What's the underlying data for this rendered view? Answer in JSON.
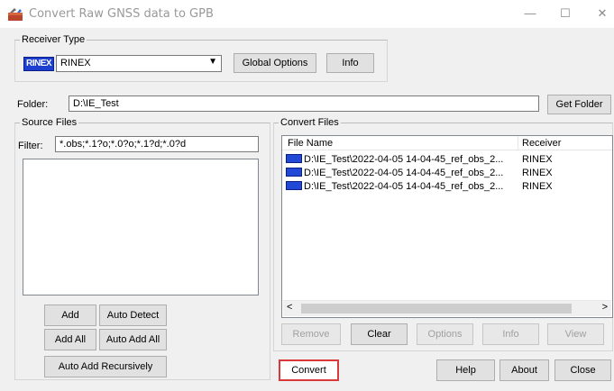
{
  "window": {
    "title": "Convert Raw GNSS data to GPB",
    "minimize_glyph": "—",
    "maximize_glyph": "☐",
    "close_glyph": "✕",
    "app_icon": "toolbox-icon"
  },
  "receiver_type": {
    "group_label": "Receiver Type",
    "badge": "RINEX",
    "selected": "RINEX",
    "global_options_label": "Global Options",
    "info_label": "Info"
  },
  "folder": {
    "label": "Folder:",
    "value": "D:\\IE_Test",
    "get_folder_label": "Get Folder"
  },
  "source_files": {
    "group_label": "Source Files",
    "filter_label": "Filter:",
    "filter_value": "*.obs;*.1?o;*.0?o;*.1?d;*.0?d",
    "buttons": {
      "add": "Add",
      "auto_detect": "Auto Detect",
      "add_all": "Add All",
      "auto_add_all": "Auto Add All",
      "auto_add_recursively": "Auto Add Recursively"
    }
  },
  "convert_files": {
    "group_label": "Convert Files",
    "columns": [
      "File Name",
      "Receiver"
    ],
    "rows": [
      {
        "file": "D:\\IE_Test\\2022-04-05 14-04-45_ref_obs_2...",
        "receiver": "RINEX"
      },
      {
        "file": "D:\\IE_Test\\2022-04-05 14-04-45_ref_obs_2...",
        "receiver": "RINEX"
      },
      {
        "file": "D:\\IE_Test\\2022-04-05 14-04-45_ref_obs_2...",
        "receiver": "RINEX"
      }
    ],
    "buttons": {
      "remove": "Remove",
      "clear": "Clear",
      "options": "Options",
      "info": "Info",
      "view": "View"
    }
  },
  "bottom": {
    "convert": "Convert",
    "help": "Help",
    "about": "About",
    "close": "Close"
  },
  "colors": {
    "convert_highlight": "#d9393a",
    "rinex_badge": "#1c3fd0"
  }
}
